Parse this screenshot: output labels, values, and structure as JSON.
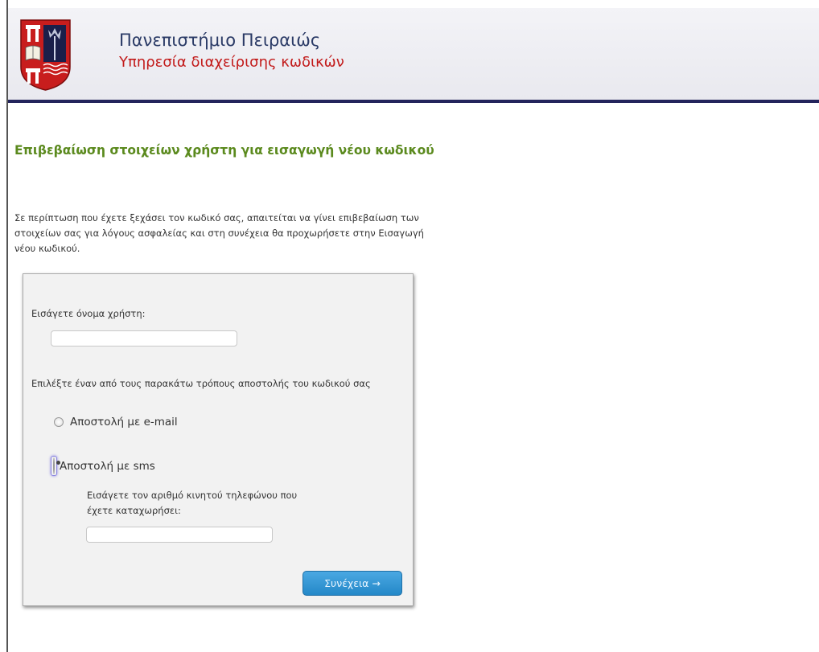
{
  "header": {
    "university": "Πανεπιστήμιο Πειραιώς",
    "service": "Υπηρεσία διαχείρισης κωδικών",
    "logo_icon": "university-crest-icon"
  },
  "page_title": "Επιβεβαίωση στοιχείων χρήστη για εισαγωγή νέου κωδικού",
  "intro": "Σε περίπτωση που έχετε ξεχάσει τον κωδικό σας, απαιτείται να γίνει επιβεβαίωση των στοιχείων σας για λόγους ασφαλείας και στη συνέχεια θα προχωρήσετε στην Εισαγωγή νέου κωδικού.",
  "form": {
    "username_label": "Εισάγετε όνομα χρήστη:",
    "username_value": "",
    "method_label": "Επιλέξτε έναν από τους παρακάτω τρόπους αποστολής του κωδικού σας",
    "options": [
      {
        "label": "Αποστολή με e-mail",
        "checked": false
      },
      {
        "label": "Αποστολή με sms",
        "checked": true
      }
    ],
    "phone_label": "Εισάγετε τον αριθμό κινητού τηλεφώνου που έχετε καταχωρήσει:",
    "phone_value": "",
    "continue_label": "Συνέχεια →"
  },
  "colors": {
    "header_bar": "#23245c",
    "title_green": "#5b8a1e",
    "service_red": "#c21a1a",
    "button_blue": "#2488c8"
  }
}
